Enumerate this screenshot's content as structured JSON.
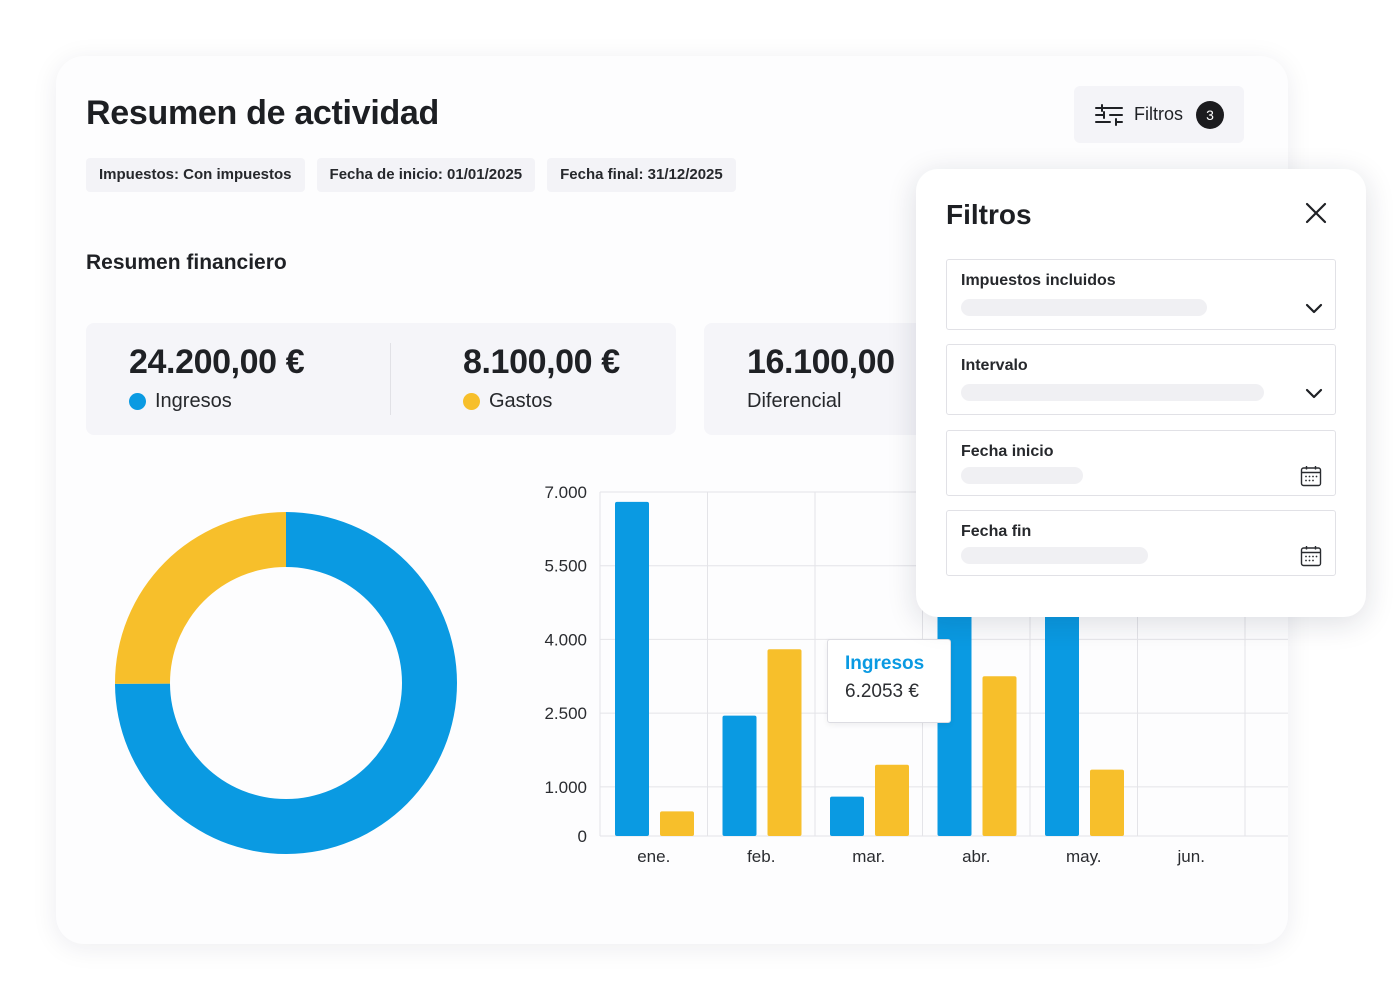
{
  "header": {
    "title": "Resumen de actividad",
    "filter_button": {
      "label": "Filtros",
      "count": "3"
    }
  },
  "chips": [
    "Impuestos: Con impuestos",
    "Fecha de inicio: 01/01/2025",
    "Fecha final: 31/12/2025"
  ],
  "summary": {
    "title": "Resumen financiero",
    "stats": [
      {
        "value": "24.200,00 €",
        "label": "Ingresos"
      },
      {
        "value": "8.100,00 €",
        "label": "Gastos"
      },
      {
        "value": "16.100,00",
        "label": "Diferencial"
      }
    ]
  },
  "colors": {
    "ingresos": "#0a9ae2",
    "gastos": "#f7bf2b"
  },
  "icons": [
    "tune-icon",
    "close-icon",
    "chevron-down-icon",
    "calendar-icon"
  ],
  "tooltip": {
    "title": "Ingresos",
    "value": "6.2053 €"
  },
  "filters_panel": {
    "title": "Filtros",
    "fields": [
      {
        "label": "Impuestos incluidos",
        "control": "select"
      },
      {
        "label": "Intervalo",
        "control": "select"
      },
      {
        "label": "Fecha inicio",
        "control": "date"
      },
      {
        "label": "Fecha fin",
        "control": "date"
      }
    ]
  },
  "chart_data": [
    {
      "type": "pie",
      "variant": "donut",
      "slices": [
        {
          "name": "Ingresos",
          "value": 24200
        },
        {
          "name": "Gastos",
          "value": 8100
        }
      ]
    },
    {
      "type": "bar",
      "categories": [
        "ene.",
        "feb.",
        "mar.",
        "abr.",
        "may.",
        "jun."
      ],
      "series": [
        {
          "name": "Ingresos",
          "values": [
            6800,
            2450,
            800,
            5600,
            5800,
            null
          ]
        },
        {
          "name": "Gastos",
          "values": [
            500,
            3800,
            1450,
            3250,
            1350,
            null
          ]
        }
      ],
      "yticks": [
        "0",
        "1.000",
        "2.500",
        "4.000",
        "5.500",
        "7.000"
      ],
      "ytick_values": [
        0,
        1000,
        2500,
        4000,
        5500,
        7000
      ],
      "grid": true
    }
  ]
}
